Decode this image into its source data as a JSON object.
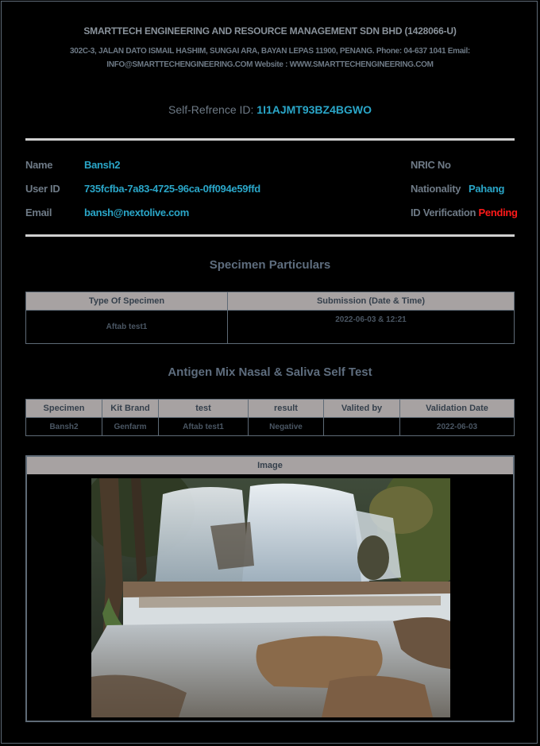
{
  "header": {
    "company": "SMARTTECH ENGINEERING AND RESOURCE MANAGEMENT SDN BHD (1428066-U)",
    "address_line1": "302C-3, JALAN DATO ISMAIL HASHIM, SUNGAI ARA, BAYAN LEPAS 11900, PENANG. Phone: 04-637 1041 Email:",
    "address_line2": "INFO@SMARTTECHENGINEERING.COM Website : WWW.SMARTTECHENGINEERING.COM"
  },
  "reference": {
    "label": "Self-Refrence ID:",
    "value": "1I1AJMT93BZ4BGWO"
  },
  "user": {
    "name_label": "Name",
    "name": "Bansh2",
    "userid_label": "User ID",
    "userid": "735fcfba-7a83-4725-96ca-0ff094e59ffd",
    "email_label": "Email",
    "email": "bansh@nextolive.com",
    "nric_label": "NRIC No",
    "nric": "",
    "nationality_label": "Nationality",
    "nationality": "Pahang",
    "idver_label": "ID Verification",
    "idver_status": "Pending"
  },
  "specimen": {
    "title": "Specimen Particulars",
    "headers": [
      "Type Of Specimen",
      "Submission (Date & Time)"
    ],
    "row": [
      "Aftab test1",
      "2022-06-03 & 12:21"
    ]
  },
  "antigen": {
    "title": "Antigen Mix Nasal & Saliva Self Test",
    "headers": [
      "Specimen",
      "Kit Brand",
      "test",
      "result",
      "Valited by",
      "Validation Date"
    ],
    "row": [
      "Bansh2",
      "Genfarm",
      "Aftab test1",
      "Negative",
      "",
      "2022-06-03"
    ]
  },
  "image": {
    "header": "Image",
    "icon": "waterfall-photo"
  },
  "colors": {
    "accent": "#2aa6c8",
    "pending": "#ff1a1a",
    "table_header": "#a7a2a2"
  }
}
